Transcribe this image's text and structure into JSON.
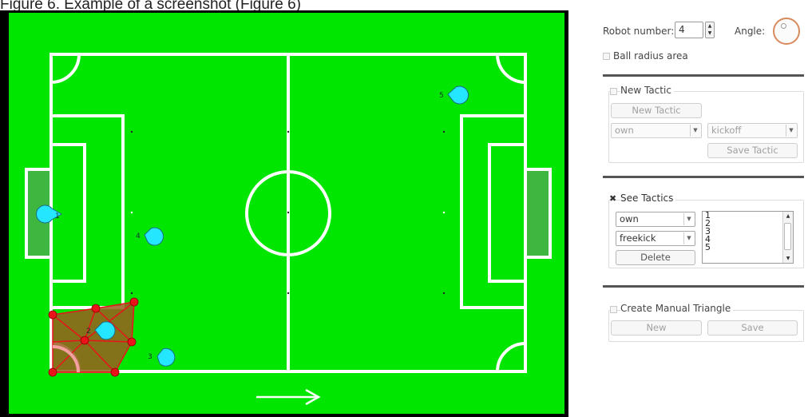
{
  "caption": "Figure 6. Example of a screenshot (Figure 6)",
  "panel": {
    "robot_number_label": "Robot number:",
    "robot_number_value": "4",
    "angle_label": "Angle:",
    "ball_radius_label": "Ball radius area",
    "new_tactic": {
      "group_label": "New Tactic",
      "button_label": "New Tactic",
      "side_value": "own",
      "mode_value": "kickoff",
      "save_label": "Save Tactic"
    },
    "see_tactics": {
      "group_label": "See Tactics",
      "side_value": "own",
      "mode_value": "freekick",
      "delete_label": "Delete",
      "list_items": [
        "1",
        "2",
        "3",
        "4",
        "5"
      ]
    },
    "manual_triangle": {
      "group_label": "Create Manual Triangle",
      "new_label": "New",
      "save_label": "Save"
    }
  },
  "field": {
    "robots": [
      {
        "label": "1"
      },
      {
        "label": "4"
      },
      {
        "label": "5"
      },
      {
        "label": "2"
      },
      {
        "label": "3"
      }
    ],
    "colors": {
      "field": "#00e600",
      "lines": "#ffffff",
      "goal": "#3fb63f",
      "robot": "#25e6ff",
      "triangle_fill": "#9a5d1f",
      "triangle_vertex": "#e8141a"
    }
  }
}
